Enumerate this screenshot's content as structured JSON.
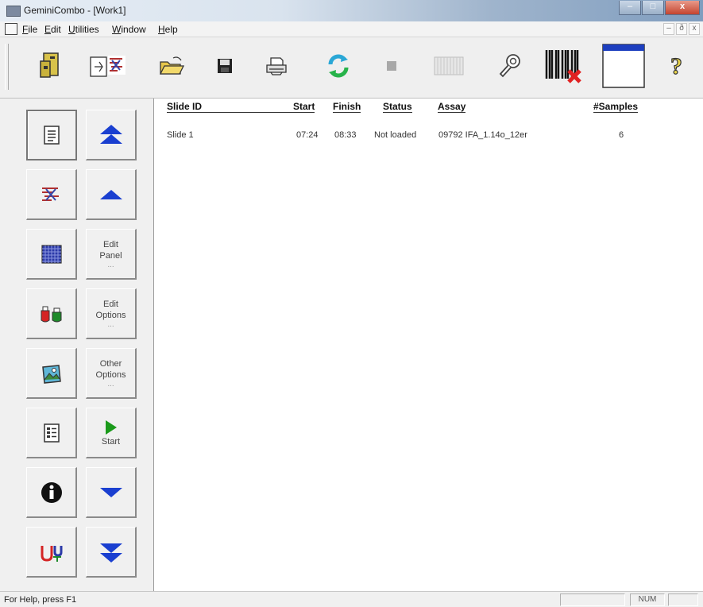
{
  "window": {
    "title": "GeminiCombo - [Work1]",
    "controls": {
      "minimize": "–",
      "maximize": "□",
      "close": "x"
    }
  },
  "menu": {
    "items": [
      {
        "label_u": "F",
        "label_rest": "ile"
      },
      {
        "label_u": "E",
        "label_rest": "dit"
      },
      {
        "label_u": "U",
        "label_rest": "tilities"
      },
      {
        "label_u": "W",
        "label_rest": "indow"
      },
      {
        "label_u": "H",
        "label_rest": "elp"
      }
    ],
    "mdi_controls": [
      "–",
      "ð",
      "x"
    ]
  },
  "toolbar": {
    "buttons": [
      "instrument-icon",
      "new-worklist-icon",
      "open-folder-icon",
      "save-disk-icon",
      "print-icon",
      "refresh-icon",
      "stop-icon",
      "plate-icon",
      "wrench-icon",
      "barcode-cancel-icon",
      "window-icon",
      "help-icon"
    ]
  },
  "left_panel": {
    "edit_panel": {
      "line1": "Edit",
      "line2": "Panel",
      "dots": "..."
    },
    "edit_options": {
      "line1": "Edit",
      "line2": "Options",
      "dots": "..."
    },
    "other_options": {
      "line1": "Other",
      "line2": "Options",
      "dots": "..."
    },
    "start": {
      "label": "Start"
    }
  },
  "table": {
    "columns": {
      "slide_id": "Slide ID",
      "start": "Start",
      "finish": "Finish",
      "status": "Status",
      "assay": "Assay",
      "samples": "#Samples"
    },
    "rows": [
      {
        "slide_id": "Slide 1",
        "start": "07:24",
        "finish": "08:33",
        "status": "Not loaded",
        "assay": "09792 IFA_1.14o_12er",
        "samples": "6"
      }
    ]
  },
  "status_bar": {
    "message": "For Help, press F1",
    "num": "NUM"
  },
  "colors": {
    "arrow_blue": "#1a3fd0",
    "start_green": "#1a9a1a",
    "window_blue": "#1d3fbf"
  }
}
